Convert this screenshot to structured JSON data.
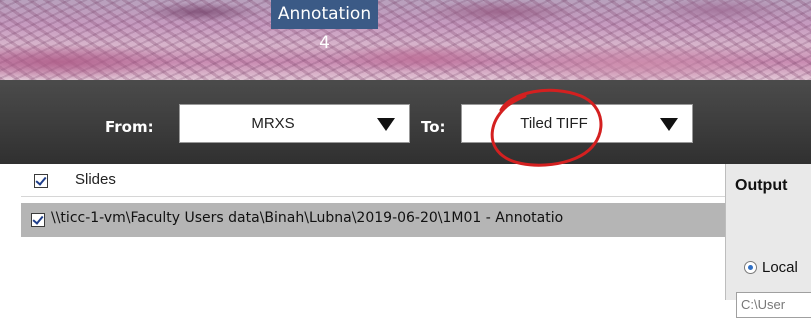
{
  "banner": {
    "title": "Annotation 4"
  },
  "toolbar": {
    "from_label": "From:",
    "from_value": "MRXS",
    "to_label": "To:",
    "to_value": "Tiled TIFF"
  },
  "slides": {
    "header_label": "Slides",
    "header_checked": true,
    "rows": [
      {
        "checked": true,
        "path": "\\\\ticc-1-vm\\Faculty  Users data\\Binah\\Lubna\\2019-06-20\\1M01 - Annotatio"
      }
    ]
  },
  "output": {
    "title": "Output",
    "local_label": "Local",
    "path_value": "C:\\User"
  },
  "colors": {
    "title_bg": "#3b5a86",
    "toolbar_bg": "#3e3e3e",
    "row_selected_bg": "#b5b5b5",
    "annotation_circle": "#d42020"
  }
}
